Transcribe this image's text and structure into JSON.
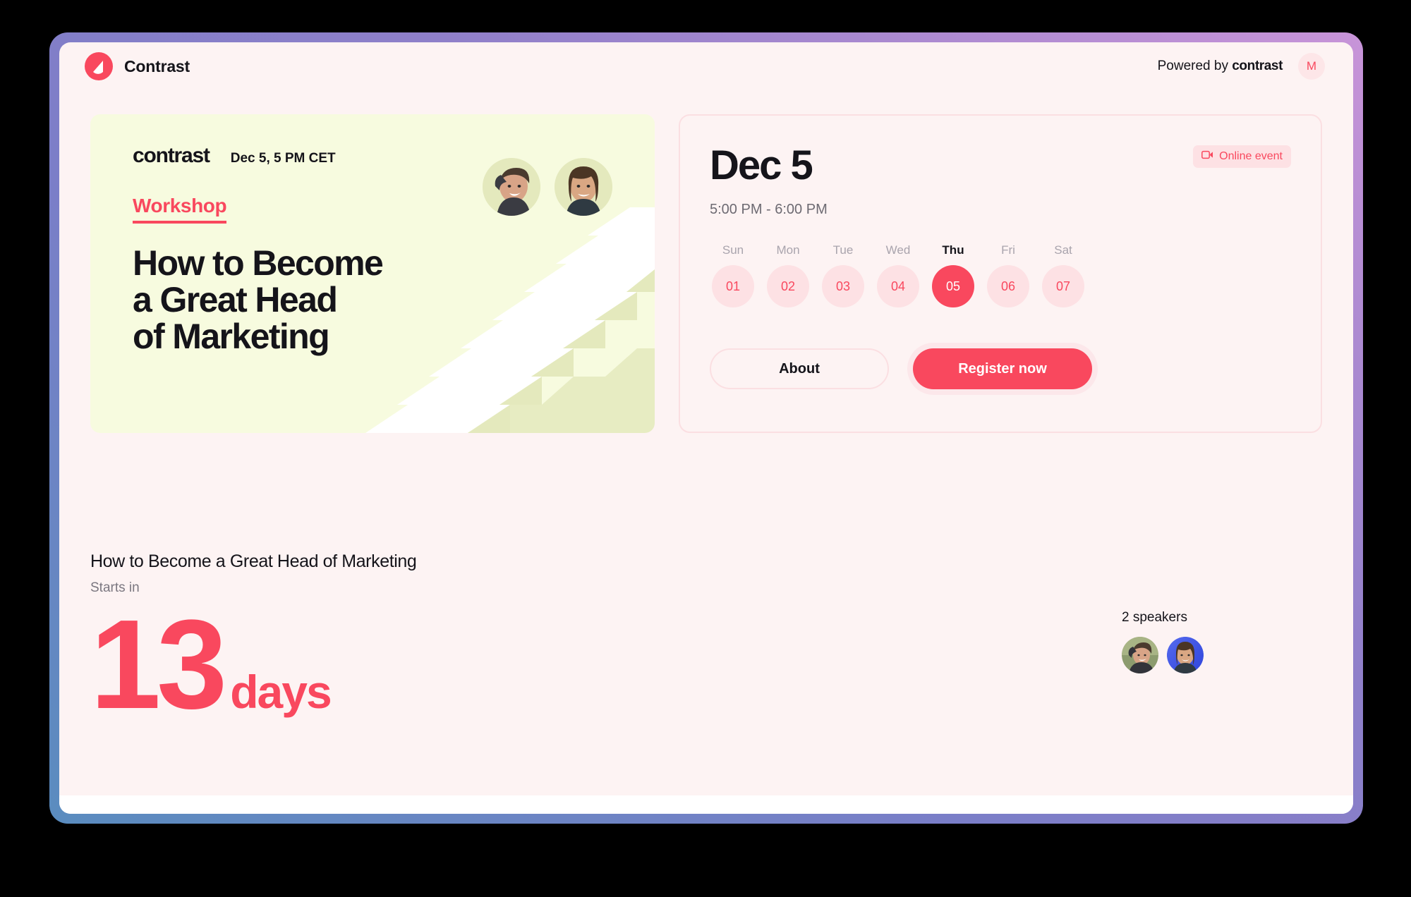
{
  "theme": {
    "accent": "#f9485e",
    "page_bg": "#fdf3f3",
    "promo_bg": "#f7fbdf",
    "badge_bg": "#fde1e4",
    "frame_gradient_from": "#5a8cbf",
    "frame_gradient_to": "#c894d8"
  },
  "header": {
    "logo_icon": "contrast-droplet-icon",
    "brand": "Contrast",
    "powered_prefix": "Powered by",
    "powered_brand": "contrast",
    "avatar_initial": "M"
  },
  "promo": {
    "logo": "contrast",
    "date": "Dec 5, 5 PM CET",
    "tag": "Workshop",
    "title": "How to Become\na Great Head\nof Marketing",
    "illustration": "stairs-illustration",
    "faces": [
      {
        "name": "speaker-1-face",
        "alt": "laughing woman portrait"
      },
      {
        "name": "speaker-2-face",
        "alt": "smiling man portrait"
      }
    ]
  },
  "detail": {
    "date": "Dec 5",
    "time": "5:00 PM - 6:00 PM",
    "badge": {
      "icon": "video-camera-icon",
      "label": "Online event"
    },
    "days": [
      {
        "name": "Sun",
        "num": "01",
        "active": false
      },
      {
        "name": "Mon",
        "num": "02",
        "active": false
      },
      {
        "name": "Tue",
        "num": "03",
        "active": false
      },
      {
        "name": "Wed",
        "num": "04",
        "active": false
      },
      {
        "name": "Thu",
        "num": "05",
        "active": true
      },
      {
        "name": "Fri",
        "num": "06",
        "active": false
      },
      {
        "name": "Sat",
        "num": "07",
        "active": false
      }
    ],
    "about_label": "About",
    "register_label": "Register now"
  },
  "lower": {
    "title": "How to Become a Great Head of Marketing",
    "starts_label": "Starts in",
    "countdown_value": "13",
    "countdown_unit": "days",
    "speakers_label": "2 speakers",
    "speakers": [
      {
        "name": "speaker-avatar-1"
      },
      {
        "name": "speaker-avatar-2"
      }
    ]
  }
}
